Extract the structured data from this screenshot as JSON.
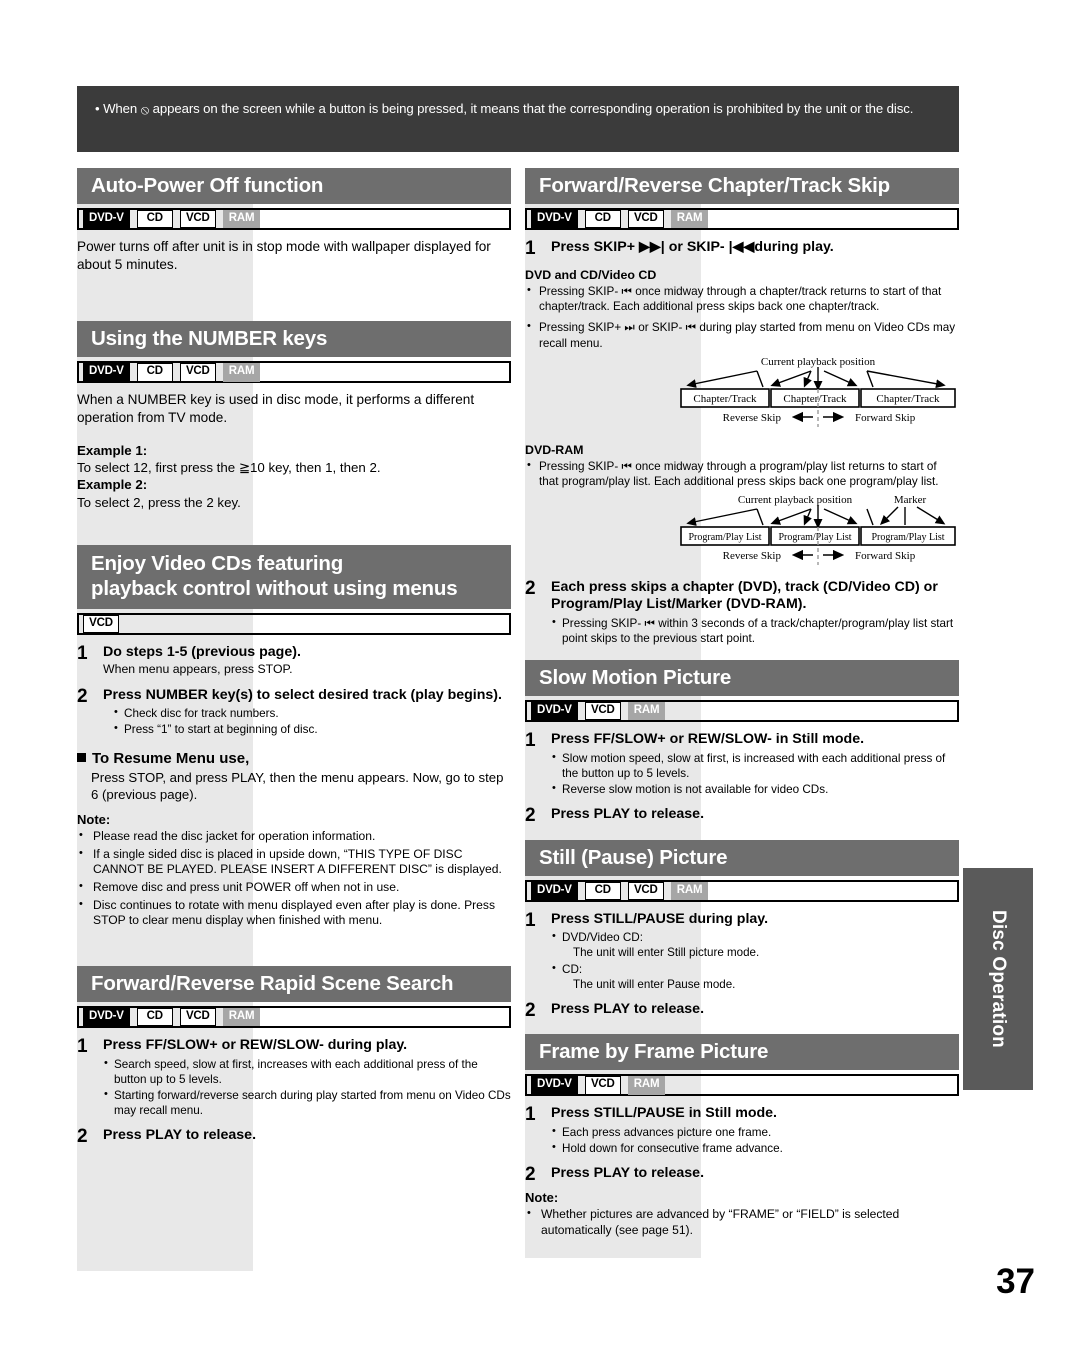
{
  "notice": {
    "text_before_icon": "• When ",
    "icon": "prohibited-icon",
    "icon_glyph": "⦸",
    "text_after_icon": " appears on the screen while a button is being pressed, it means that the corresponding operation is prohibited by the unit or the disc."
  },
  "badges": {
    "dvdv": "DVD-V",
    "cd": "CD",
    "vcd": "VCD",
    "ram": "RAM"
  },
  "left": {
    "auto_power": {
      "title": "Auto-Power Off function",
      "body": "Power turns off after unit is in stop mode with wallpaper displayed for about 5 minutes."
    },
    "number_keys": {
      "title": "Using the NUMBER keys",
      "body": "When a NUMBER key is used in disc mode, it performs a different operation from TV mode.",
      "example1_label": "Example 1:",
      "example1_text": "To select 12, first press the ≧10 key, then 1, then 2.",
      "example2_label": "Example 2:",
      "example2_text": "To select 2, press the 2 key."
    },
    "video_cds": {
      "title_line1": "Enjoy Video CDs featuring",
      "title_line2": "playback control without using menus",
      "steps": [
        {
          "num": "1",
          "title": "Do steps 1-5 (previous page).",
          "sub": "When menu appears, press STOP.",
          "bullets": []
        },
        {
          "num": "2",
          "title": "Press NUMBER key(s) to select desired track (play begins).",
          "sub": "",
          "bullets": [
            "Check disc for track numbers.",
            "Press “1” to start at beginning of disc."
          ]
        }
      ],
      "resume_head": "To Resume Menu use,",
      "resume_body": "Press STOP, and press PLAY, then the menu appears. Now, go to step 6 (previous page).",
      "note_label": "Note:",
      "notes": [
        "Please read the disc jacket for operation information.",
        "If a single sided disc is placed in upside down, “THIS TYPE OF DISC CANNOT BE PLAYED. PLEASE INSERT A DIFFERENT DISC” is displayed.",
        "Remove disc and press unit POWER off when not in use.",
        "Disc continues to rotate with menu displayed even after play is done. Press STOP to clear menu display when finished with menu."
      ]
    },
    "scene_search": {
      "title": "Forward/Reverse Rapid Scene Search",
      "steps": [
        {
          "num": "1",
          "title": "Press FF/SLOW+ or REW/SLOW- during play.",
          "bullets": [
            "Search speed, slow at first, increases with each additional press of the button up to 5 levels.",
            "Starting forward/reverse search during play started from menu on Video CDs may recall menu."
          ]
        },
        {
          "num": "2",
          "title": "Press PLAY to release.",
          "bullets": []
        }
      ]
    }
  },
  "right": {
    "chapter_skip": {
      "title": "Forward/Reverse Chapter/Track Skip",
      "step1_num": "1",
      "step1_title_a": "Press SKIP+ ",
      "step1_icon_fwd": "skip-forward-icon",
      "step1_title_b": " or SKIP- ",
      "step1_icon_rev": "skip-reverse-icon",
      "step1_title_c": "during play.",
      "dvd_cd_head": "DVD and CD/Video CD",
      "dvd_cd_bullets": [
        "Pressing SKIP- ⏮ once midway through a chapter/track returns to start of that chapter/track. Each additional press skips back one chapter/track.",
        "Pressing SKIP+ ⏭ or SKIP- ⏮ during play started from menu on Video CDs may recall menu."
      ],
      "diagram1": {
        "caption": "Current playback position",
        "boxes": [
          "Chapter/Track",
          "Chapter/Track",
          "Chapter/Track"
        ],
        "reverse_label": "Reverse Skip",
        "forward_label": "Forward Skip",
        "marker_label": ""
      },
      "ram_head": "DVD-RAM",
      "ram_bullets": [
        "Pressing SKIP- ⏮ once midway through a program/play list returns to start of that program/play list. Each additional press skips back one program/play list."
      ],
      "diagram2": {
        "caption": "Current playback position",
        "marker_label": "Marker",
        "boxes": [
          "Program/Play List",
          "Program/Play List",
          "Program/Play List"
        ],
        "reverse_label": "Reverse Skip",
        "forward_label": "Forward Skip"
      },
      "step2_num": "2",
      "step2_title": "Each press skips a chapter (DVD), track (CD/Video CD) or Program/Play List/Marker (DVD-RAM).",
      "step2_bullets": [
        "Pressing SKIP- ⏮ within 3 seconds of a track/chapter/program/play list start point skips to the previous start point."
      ]
    },
    "slow_motion": {
      "title": "Slow Motion Picture",
      "steps": [
        {
          "num": "1",
          "title": "Press FF/SLOW+ or REW/SLOW- in Still mode.",
          "bullets": [
            "Slow motion speed, slow at first, is increased with each additional press of the button up to 5 levels.",
            "Reverse slow motion is not available for video CDs."
          ]
        },
        {
          "num": "2",
          "title": "Press PLAY to release.",
          "bullets": []
        }
      ]
    },
    "still_pause": {
      "title": "Still (Pause) Picture",
      "steps": [
        {
          "num": "1",
          "title": "Press STILL/PAUSE during play.",
          "bullets": [
            "DVD/Video CD:",
            "CD:"
          ],
          "sub_lines": [
            "The unit will enter Still picture mode.",
            "The unit will enter Pause mode."
          ]
        },
        {
          "num": "2",
          "title": "Press PLAY to release.",
          "bullets": []
        }
      ]
    },
    "frame_by_frame": {
      "title": "Frame by Frame Picture",
      "steps": [
        {
          "num": "1",
          "title": "Press STILL/PAUSE in Still mode.",
          "bullets": [
            "Each press advances picture one frame.",
            "Hold down for consecutive frame advance."
          ]
        },
        {
          "num": "2",
          "title": "Press PLAY to release.",
          "bullets": []
        }
      ],
      "note_label": "Note:",
      "notes": [
        "Whether pictures are advanced by “FRAME” or “FIELD” is selected automatically (see page 51)."
      ]
    }
  },
  "side_tab": {
    "label": "Disc Operation"
  },
  "page_number": "37",
  "colors": {
    "header_gray": "#6e6e6e",
    "notice_dark": "#3b3b3b",
    "band_gray": "#e8e8e8",
    "ram_gray": "#a6a6a6",
    "side_tab_gray": "#5a5a5a"
  }
}
